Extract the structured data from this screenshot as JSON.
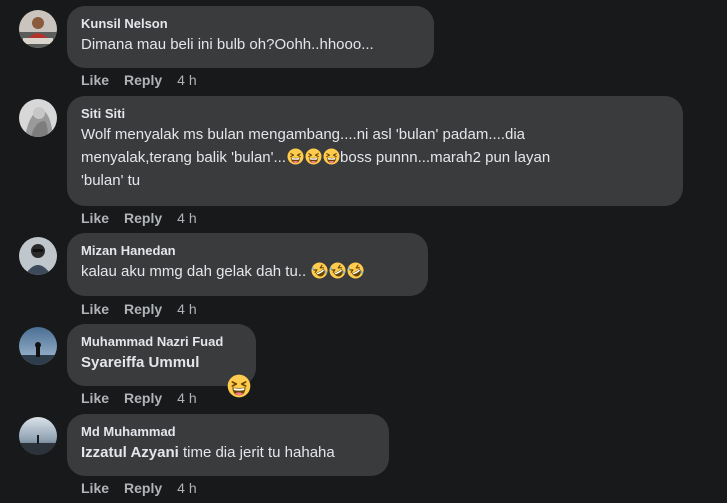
{
  "comments": [
    {
      "author": "Kunsil Nelson",
      "text": "Dimana mau beli ini bulb oh?Oohh..hhooo...",
      "like": "Like",
      "reply": "Reply",
      "time": "4 h"
    },
    {
      "author": "Siti Siti",
      "line1": "Wolf menyalak ms bulan mengambang....ni asl 'bulan' padam....dia",
      "line2_before": "menyalak,terang balik 'bulan'...",
      "line2_after": "boss punnn...marah2 pun layan",
      "line3": "'bulan' tu",
      "emoji": [
        "grinning-squinting-face",
        "grinning-squinting-face",
        "grinning-squinting-face"
      ],
      "like": "Like",
      "reply": "Reply",
      "time": "4 h"
    },
    {
      "author": "Mizan Hanedan",
      "text": "kalau aku mmg dah gelak dah tu..",
      "emoji": [
        "rolling-on-floor-laughing",
        "rolling-on-floor-laughing",
        "rolling-on-floor-laughing"
      ],
      "like": "Like",
      "reply": "Reply",
      "time": "4 h"
    },
    {
      "author": "Muhammad Nazri Fuad",
      "mention": "Syareiffa Ummul",
      "emoji": "grinning-squinting-face",
      "like": "Like",
      "reply": "Reply",
      "time": "4 h"
    },
    {
      "author": "Md Muhammad",
      "mention": "Izzatul Azyani",
      "text": " time dia jerit tu hahaha",
      "like": "Like",
      "reply": "Reply",
      "time": "4 h"
    }
  ],
  "colors": {
    "background": "#18191a",
    "bubble": "#3a3b3c",
    "text": "#e4e6eb",
    "secondary": "#b0b3b8",
    "emoji_yellow": "#ffcc4d"
  }
}
